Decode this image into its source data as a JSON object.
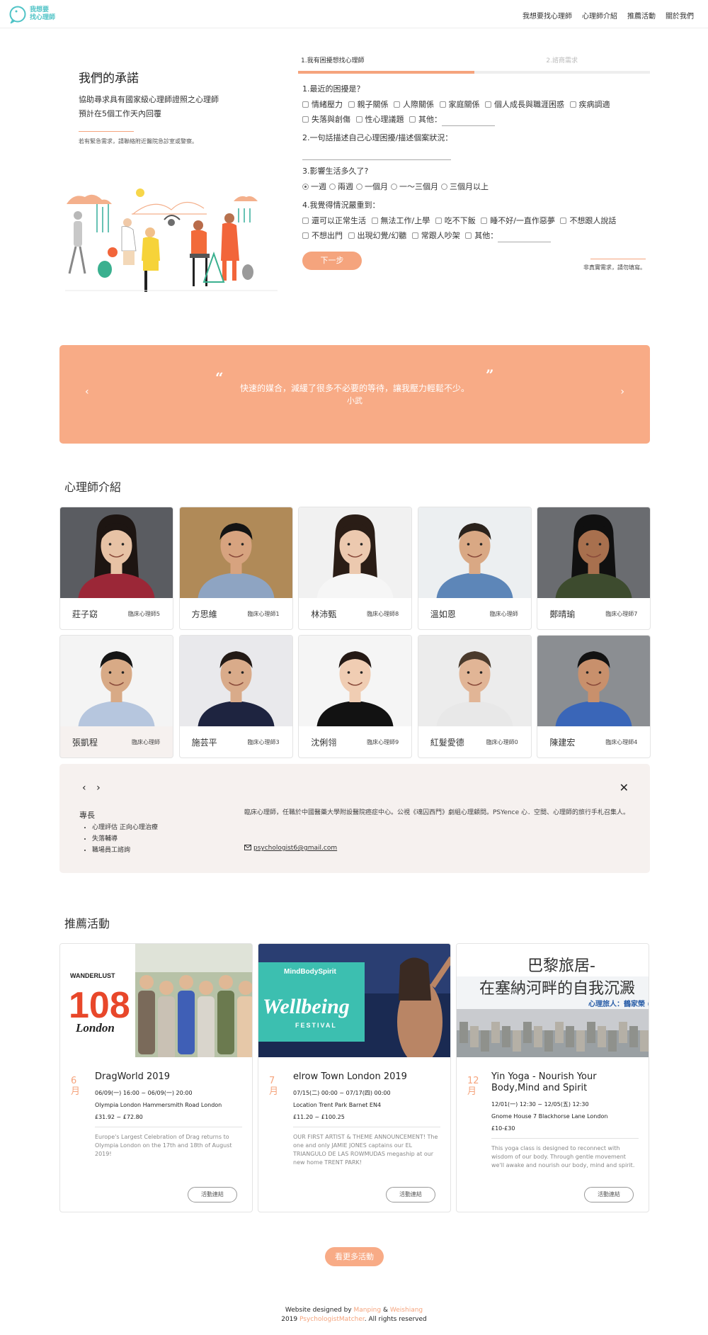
{
  "brand": {
    "logo_line1": "我想要",
    "logo_line2": "找心理師"
  },
  "nav": [
    "我想要找心理師",
    "心理師介紹",
    "推薦活動",
    "關於我們"
  ],
  "promise": {
    "title": "我們的承諾",
    "line1": "協助尋求具有國家級心理師證照之心理師",
    "line2": "預計在5個工作天內回覆",
    "note": "若有緊急需求，請聯絡附近醫院急診室或警察。"
  },
  "form": {
    "step1": "1.我有困擾想找心理師",
    "step2": "2.諮商需求",
    "progress": 0.5,
    "q1": {
      "title": "1.最近的困擾是？",
      "options": [
        "情緒壓力",
        "親子關係",
        "人際關係",
        "家庭關係",
        "個人成長與職涯困惑",
        "疾病調適",
        "失落與創傷",
        "性心理議題",
        "其他："
      ]
    },
    "q2": {
      "title": "2.一句話描述自己心理困擾/描述個案狀況："
    },
    "q3": {
      "title": "3.影響生活多久了?",
      "options": [
        "一週",
        "兩週",
        "一個月",
        "一～三個月",
        "三個月以上"
      ],
      "selected": "一週"
    },
    "q4": {
      "title": "4.我覺得情況嚴重到：",
      "options": [
        "還可以正常生活",
        "無法工作/上學",
        "吃不下飯",
        "睡不好/一直作惡夢",
        "不想跟人說話",
        "不想出門",
        "出現幻覺/幻聽",
        "常跟人吵架",
        "其他："
      ]
    },
    "next": "下一步",
    "note": "非真實需求，請勿填寫。"
  },
  "testimonial": {
    "text": "快速的媒合，減緩了很多不必要的等待，讓我壓力輕鬆不少。",
    "author": "小武",
    "quote_open": "“",
    "quote_close": "”",
    "prev": "‹",
    "next": "›"
  },
  "psychologists_title": "心理師介紹",
  "psychologists": [
    {
      "name": "莊子窈",
      "title": "臨床心理師5",
      "bg": "#5a5c61",
      "skin": "#e7c2a5",
      "hair": "#1d1512",
      "shirt": "#9b2737",
      "long": true
    },
    {
      "name": "方思維",
      "title": "臨床心理師1",
      "bg": "#b08a58",
      "skin": "#d7a37f",
      "hair": "#141414",
      "shirt": "#8ea4c2",
      "long": false
    },
    {
      "name": "林沛甄",
      "title": "臨床心理師8",
      "bg": "#f1f1f1",
      "skin": "#ecc9af",
      "hair": "#2a1d16",
      "shirt": "#f6f6f6",
      "long": true
    },
    {
      "name": "溫如恩",
      "title": "臨床心理師",
      "bg": "#eceff1",
      "skin": "#d9a884",
      "hair": "#2a221c",
      "shirt": "#5d86b8",
      "long": false
    },
    {
      "name": "鄭晴瑜",
      "title": "臨床心理師7",
      "bg": "#6a6c70",
      "skin": "#a8704e",
      "hair": "#101010",
      "shirt": "#3d4b2e",
      "long": true
    },
    {
      "name": "張凱程",
      "title": "臨床心理師",
      "bg": "#f4f4f4",
      "skin": "#d8aa86",
      "hair": "#161616",
      "shirt": "#b6c6de",
      "long": false
    },
    {
      "name": "施芸平",
      "title": "臨床心理師3",
      "bg": "#e9e9ec",
      "skin": "#d9ab8a",
      "hair": "#231a16",
      "shirt": "#1e2440",
      "long": false
    },
    {
      "name": "沈俐翎",
      "title": "臨床心理師9",
      "bg": "#f5f5f5",
      "skin": "#f0cdb3",
      "hair": "#241915",
      "shirt": "#121212",
      "long": false
    },
    {
      "name": "紅髮愛德",
      "title": "臨床心理師0",
      "bg": "#ececec",
      "skin": "#e1b596",
      "hair": "#4a3a2c",
      "shirt": "#e8e8e8",
      "long": false
    },
    {
      "name": "陳建宏",
      "title": "臨床心理師4",
      "bg": "#8b8e92",
      "skin": "#c8906c",
      "hair": "#121212",
      "shirt": "#3a66b8",
      "long": false
    }
  ],
  "detail": {
    "prev": "‹",
    "next": "›",
    "close": "✕",
    "spec_title": "專長",
    "specs": [
      "心理評估 正向心理治療",
      "失落輔導",
      "職場員工諮詢"
    ],
    "bio": "臨床心理師，任職於中國醫藥大學附設醫院癌症中心。公視《魂囚西門》劇組心理顧問。PSYence 心．空間、心理師的旅行手札召集人。",
    "email": "psychologist6@gmail.com"
  },
  "events_title": "推薦活動",
  "events": [
    {
      "month": "6月",
      "title": "DragWorld 2019",
      "time": "06/09(一) 16:00 ~ 06/09(一) 20:00",
      "location": "Olympia London Hammersmith Road London",
      "price": "£31.92 ~ £72.80",
      "desc": "Europe's Largest Celebration of Drag returns to Olympia London on the 17th and 18th of August 2019!",
      "button": "活動連結",
      "img_a": "WANDERLUST",
      "img_b": "108",
      "img_c": "London"
    },
    {
      "month": "7月",
      "title": "elrow Town London 2019",
      "time": "07/15(二) 00:00 ~ 07/17(四) 00:00",
      "location": "Location Trent Park Barnet EN4",
      "price": "£11.20 ~ £100.25",
      "desc": "OUR FIRST ARTIST & THEME ANNOUNCEMENT! The one and only JAMIE JONES captains our EL TRIANGULO DE LAS ROWMUDAS megaship at our new home TRENT PARK!",
      "button": "活動連結",
      "img_a": "MindBodySpirit",
      "img_b": "Wellbeing",
      "img_c": "FESTIVAL"
    },
    {
      "month": "12月",
      "title": "Yin Yoga - Nourish Your Body,Mind and Spirit",
      "time": "12/01(一) 12:30 ~ 12/05(五) 12:30",
      "location": "Gnome House 7 Blackhorse Lane London",
      "price": "£10-£30",
      "desc": "This yoga class is designed to reconnect with wisdom of our body. Through gentle movement we'll awake and nourish our body, mind and spirit.",
      "button": "活動連結",
      "img_a": "巴黎旅居-",
      "img_b": "在塞納河畔的自我沉澱",
      "img_c": "心理旅人：鶴家榮 (",
      "narrow_month": true
    }
  ],
  "more_events": "看更多活動",
  "footer": {
    "designed_by": "Website designed by",
    "designer1": "Manping",
    "amp": "&",
    "designer2": "Weishiang",
    "year": "2019",
    "site": "PsychologistMatcher",
    "rights": ". All rights reserved"
  },
  "colors": {
    "accent": "#f8ab86",
    "teal": "#4fc3c6",
    "detail_bg": "#f6f1ef"
  }
}
